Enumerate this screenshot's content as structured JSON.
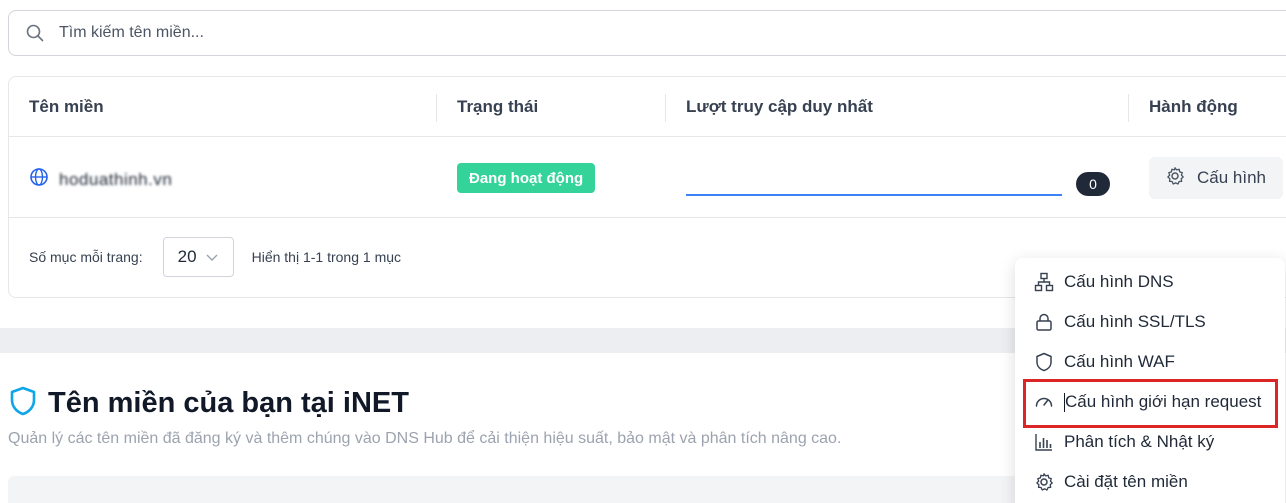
{
  "search": {
    "placeholder": "Tìm kiếm tên miền..."
  },
  "table": {
    "headers": [
      "Tên miền",
      "Trạng thái",
      "Lượt truy cập duy nhất",
      "Hành động"
    ],
    "row": {
      "domain": "hoduathinh.vn",
      "status": "Đang hoạt động",
      "unique_visits": "0",
      "action_label": "Cấu hình"
    }
  },
  "pagination": {
    "per_page_label": "Số mục mỗi trang:",
    "per_page_value": "20",
    "info": "Hiển thị 1-1 trong 1 mục"
  },
  "section": {
    "title": "Tên miền của bạn tại iNET",
    "description": "Quản lý các tên miền đã đăng ký và thêm chúng vào DNS Hub để cải thiện hiệu suất, bảo mật và phân tích nâng cao."
  },
  "menu": {
    "items": [
      {
        "label": "Cấu hình DNS",
        "icon": "network-icon"
      },
      {
        "label": "Cấu hình SSL/TLS",
        "icon": "lock-icon"
      },
      {
        "label": "Cấu hình WAF",
        "icon": "shield-icon"
      },
      {
        "label": "Cấu hình giới hạn request",
        "icon": "gauge-icon"
      },
      {
        "label": "Phân tích & Nhật ký",
        "icon": "bar-chart-icon"
      },
      {
        "label": "Cài đặt tên miền",
        "icon": "gear-icon"
      }
    ]
  },
  "colors": {
    "status_badge": "#34d399",
    "accent": "#3b82f6",
    "highlight": "#dc2626"
  }
}
